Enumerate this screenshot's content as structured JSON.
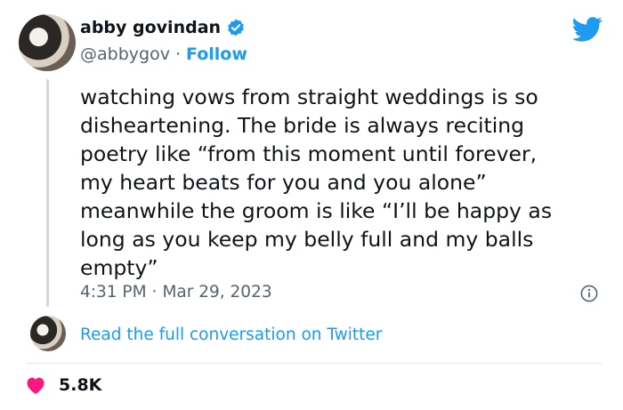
{
  "colors": {
    "accent": "#1d9bf0",
    "like": "#f91880",
    "muted": "#536471",
    "text": "#0f1419"
  },
  "author": {
    "name": "abby govindan",
    "handle": "@abbygov",
    "separator": "·",
    "follow_label": "Follow"
  },
  "icons": {
    "verified": "verified-badge-icon",
    "brand": "twitter-bird-icon",
    "info": "info-icon",
    "like": "heart-icon"
  },
  "tweet": {
    "text": "watching vows from straight weddings is so\ndisheartening. The bride is always reciting\npoetry like “from this moment until forever,\nmy heart beats for you and you alone”\nmeanwhile the groom is like “I’ll be happy as\nlong as you keep my belly full and my balls\nempty”",
    "time": "4:31 PM",
    "separator": "·",
    "date": "Mar 29, 2023"
  },
  "conversation_link": "Read the full conversation on Twitter",
  "likes": {
    "count": "5.8K"
  }
}
